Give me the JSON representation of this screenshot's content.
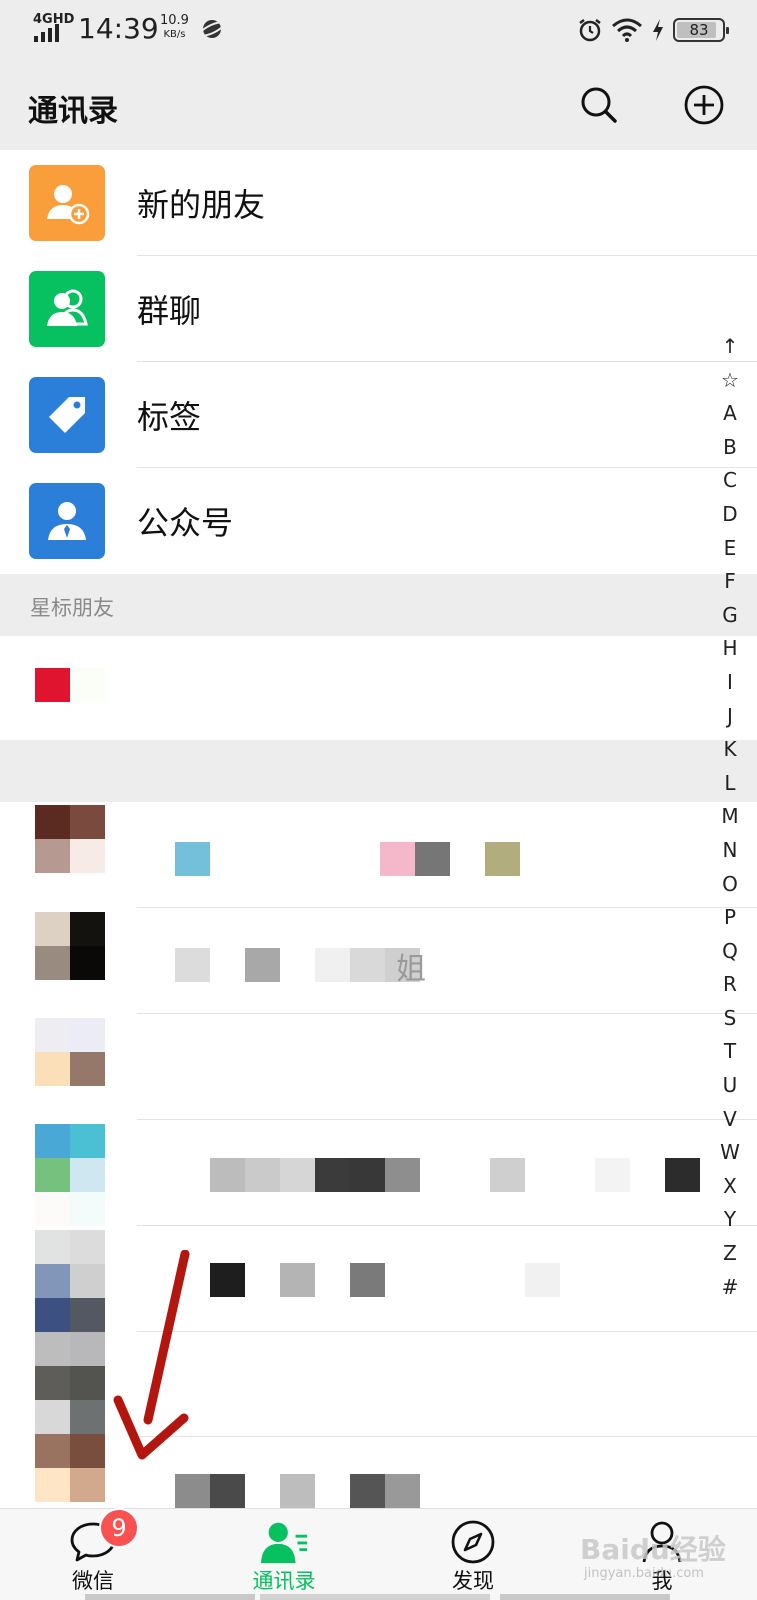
{
  "status_bar": {
    "network": "4GHD",
    "time": "14:39",
    "speed_value": "10.9",
    "speed_unit": "KB/s",
    "battery": "83",
    "icons": [
      "signal-icon",
      "planet-icon",
      "alarm-icon",
      "wifi-icon",
      "charging-icon",
      "battery-icon"
    ]
  },
  "header": {
    "title": "通讯录",
    "icons": [
      "search-icon",
      "add-icon"
    ]
  },
  "functions": [
    {
      "label": "新的朋友",
      "icon": "add-friend-icon",
      "color": "#fa9d3b"
    },
    {
      "label": "群聊",
      "icon": "group-chat-icon",
      "color": "#07c160"
    },
    {
      "label": "标签",
      "icon": "tag-icon",
      "color": "#2b7fd9"
    },
    {
      "label": "公众号",
      "icon": "official-account-icon",
      "color": "#2b7fd9"
    }
  ],
  "starred_section": {
    "title": "星标朋友"
  },
  "contacts": [
    {
      "name_visible": ""
    },
    {
      "name_visible": ""
    },
    {
      "name_visible": "姐"
    },
    {
      "name_visible": ""
    },
    {
      "name_visible": ""
    },
    {
      "name_visible": ""
    },
    {
      "name_visible": ""
    }
  ],
  "alpha_index": [
    "↑",
    "☆",
    "A",
    "B",
    "C",
    "D",
    "E",
    "F",
    "G",
    "H",
    "I",
    "J",
    "K",
    "L",
    "M",
    "N",
    "O",
    "P",
    "Q",
    "R",
    "S",
    "T",
    "U",
    "V",
    "W",
    "X",
    "Y",
    "Z",
    "#"
  ],
  "tab_bar": {
    "tabs": [
      {
        "label": "微信",
        "icon": "chat-icon",
        "active": false
      },
      {
        "label": "通讯录",
        "icon": "contacts-icon",
        "active": true
      },
      {
        "label": "发现",
        "icon": "discover-compass-icon",
        "active": false
      },
      {
        "label": "我",
        "icon": "me-person-icon",
        "active": false
      }
    ],
    "badge": "9"
  },
  "colors": {
    "accent": "#07c160",
    "badge": "#fa5151",
    "background_gray": "#ededed",
    "arrow": "#b3150f"
  },
  "watermark": {
    "text": "Baidu经验",
    "sub": "jingyan.baidu.com"
  }
}
